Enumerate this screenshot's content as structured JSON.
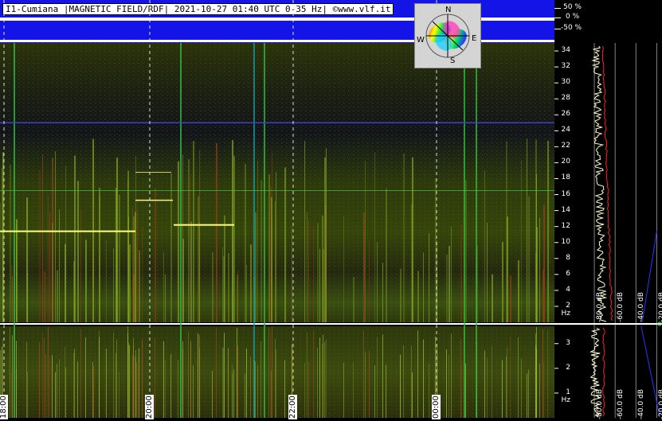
{
  "header": {
    "title": "I1-Cumiana |MAGNETIC FIELD/RDF| 2021-10-27 01:40 UTC 0-35 Hz| ©www.vlf.it",
    "percent_scale": [
      "50 %",
      "0 %",
      "-50 %"
    ]
  },
  "compass": {
    "n": "N",
    "s": "S",
    "e": "E",
    "w": "W"
  },
  "colors": {
    "header_band": "#1414e6",
    "trace_white": "#ffffcc",
    "trace_red": "#ff2020",
    "trace_blue": "#3030ff",
    "line_yellow": "#ffff80"
  },
  "chart_data": [
    {
      "type": "heatmap",
      "panel": "upper-spectrogram",
      "ylabel": "",
      "y_ticks": [
        {
          "label": "2 Hz",
          "value": 2
        },
        {
          "label": "4",
          "value": 4
        },
        {
          "label": "6",
          "value": 6
        },
        {
          "label": "8",
          "value": 8
        },
        {
          "label": "10",
          "value": 10
        },
        {
          "label": "12",
          "value": 12
        },
        {
          "label": "14",
          "value": 14
        },
        {
          "label": "16",
          "value": 16
        },
        {
          "label": "18",
          "value": 18
        },
        {
          "label": "20",
          "value": 20
        },
        {
          "label": "22",
          "value": 22
        },
        {
          "label": "24",
          "value": 24
        },
        {
          "label": "26",
          "value": 26
        },
        {
          "label": "28",
          "value": 28
        },
        {
          "label": "30",
          "value": 30
        },
        {
          "label": "32",
          "value": 32
        },
        {
          "label": "34",
          "value": 34
        }
      ],
      "ylim": [
        0,
        35
      ]
    },
    {
      "type": "heatmap",
      "panel": "lower-spectrogram",
      "y_ticks": [
        {
          "label": "1 Hz",
          "value": 1
        },
        {
          "label": "2",
          "value": 2
        },
        {
          "label": "3",
          "value": 3
        }
      ],
      "ylim": [
        0,
        3.7
      ],
      "x_ticks": [
        "18:00",
        "20:00",
        "22:00",
        "00:00"
      ]
    },
    {
      "type": "line",
      "panel": "profile",
      "db_labels_upper": [
        "-80.0 dB",
        "-60.0 dB",
        "-40.0 dB",
        "-20.0 dB"
      ],
      "db_labels_lower": [
        "-80.0 dB",
        "-60.0 dB",
        "-40.0 dB",
        "-20.0 dB"
      ],
      "xlim_db": [
        -90,
        -15
      ]
    }
  ]
}
